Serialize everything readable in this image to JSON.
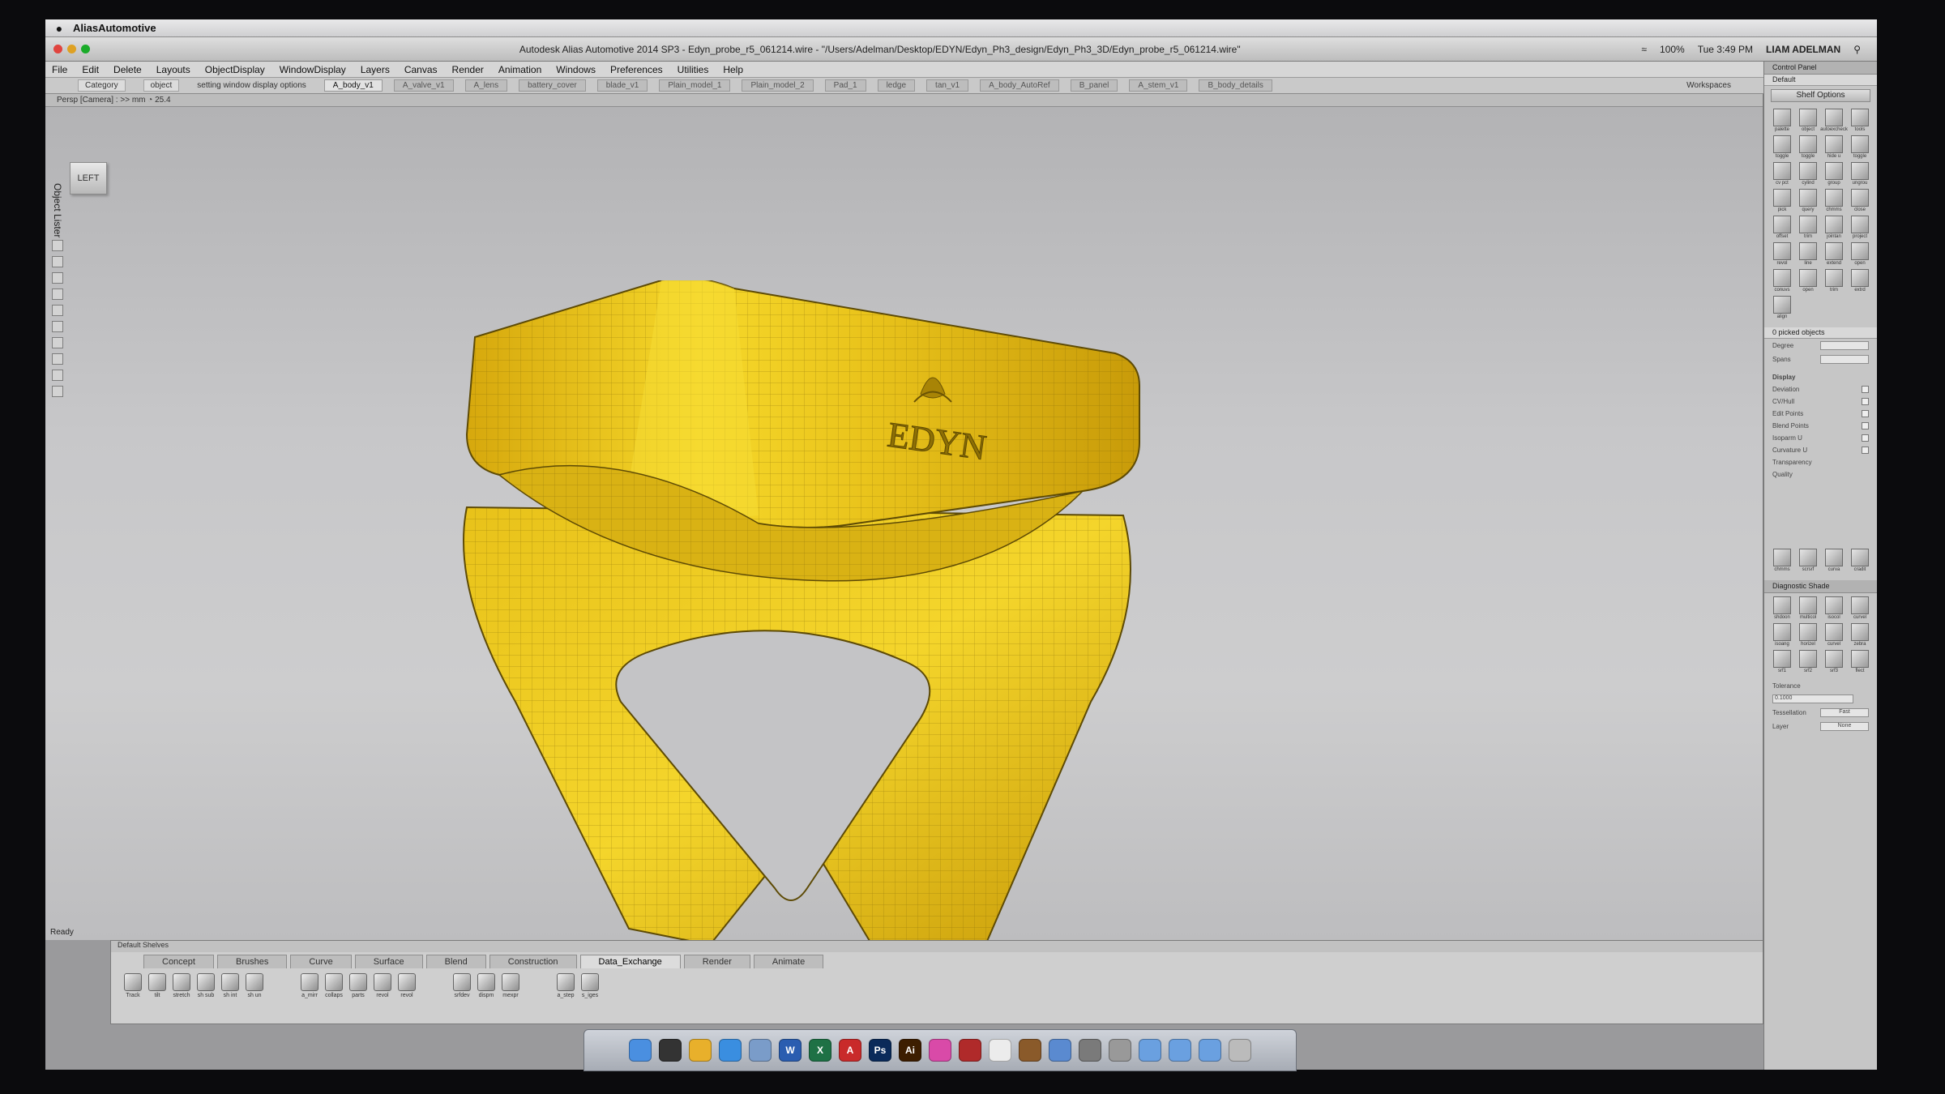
{
  "menubar": {
    "apple": "",
    "app_name": "AliasAutomotive"
  },
  "titlebar": {
    "title": "Autodesk Alias Automotive 2014 SP3  -  Edyn_probe_r5_061214.wire - \"/Users/Adelman/Desktop/EDYN/Edyn_Ph3_design/Edyn_Ph3_3D/Edyn_probe_r5_061214.wire\"",
    "battery": "100%",
    "clock": "Tue 3:49 PM",
    "user": "LIAM ADELMAN"
  },
  "app_menu": [
    "File",
    "Edit",
    "Delete",
    "Layouts",
    "ObjectDisplay",
    "WindowDisplay",
    "Layers",
    "Canvas",
    "Render",
    "Animation",
    "Windows",
    "Preferences",
    "Utilities",
    "Help"
  ],
  "shelf_row": {
    "category_label": "Category",
    "object_label": "object",
    "hint": "setting window display options",
    "tabs": [
      "A_body_v1",
      "A_valve_v1",
      "A_lens",
      "battery_cover",
      "blade_v1",
      "Plain_model_1",
      "Plain_model_2",
      "Pad_1",
      "ledge",
      "tan_v1",
      "A_body_AutoRef",
      "B_panel",
      "A_stem_v1",
      "B_body_details"
    ],
    "workspaces": "Workspaces"
  },
  "viewport": {
    "header": "Persp [Camera] : >> mm   ◔ 25.4",
    "view_cube": "LEFT",
    "object_lister": "Object Lister",
    "status": "Ready",
    "model_logo": "EDYN"
  },
  "control_panel": {
    "title": "Control Panel",
    "subtitle": "Default",
    "shelf_options": "Shelf Options",
    "tool_icons": [
      "palette",
      "object",
      "autoexcheck",
      "tools",
      "toggle",
      "toggle",
      "hide u",
      "toggle",
      "cv pct",
      "cylind",
      "group",
      "ungrou",
      "pick",
      "query",
      "chmms",
      "close",
      "offset",
      "trim",
      "jointan",
      "project",
      "revol",
      "line",
      "extend",
      "open",
      "conuvs",
      "open",
      "trim",
      "extrd",
      "align"
    ],
    "picked_objects": "0 picked objects",
    "degree_label": "Degree",
    "spans_label": "Spans",
    "display_header": "Display",
    "display_rows": [
      "Deviation",
      "CV/Hull",
      "Edit Points",
      "Blend Points",
      "Isoparm U",
      "Curvature U"
    ],
    "transparency": "Transparency",
    "quality": "Quality",
    "bottom_icons": [
      "chmms",
      "scrsrf",
      "curva",
      "cradit"
    ],
    "diagnostic_title": "Diagnostic Shade",
    "diagnostic_icons": [
      "shdoon",
      "multicol",
      "isocol",
      "curvel",
      "isoang",
      "horizel",
      "curvel",
      "zebra",
      "srf1",
      "srf2",
      "srf3",
      "flect"
    ],
    "tolerance_label": "Tolerance",
    "tolerance_value": "0.1000",
    "tessellation_label": "Tessellation",
    "tessellation_value": "Fast",
    "layer_label": "Layer",
    "layer_value": "None"
  },
  "bottom_shelf": {
    "title": "Default Shelves",
    "tabs": [
      "Concept",
      "Brushes",
      "Curve",
      "Surface",
      "Blend",
      "Construction",
      "Data_Exchange",
      "Render",
      "Animate"
    ],
    "active_tab": "Data_Exchange",
    "group1": [
      "Track",
      "tilt",
      "stretch",
      "sh sub",
      "sh int",
      "sh un"
    ],
    "group2": [
      "a_mirr",
      "collaps",
      "parts",
      "revol",
      "revol"
    ],
    "group3": [
      "srfdev",
      "dispm",
      "mexpr"
    ],
    "group4": [
      "a_step",
      "s_iges"
    ]
  },
  "dock": [
    "finder",
    "dashboard",
    "chrome",
    "safari",
    "mail",
    "word",
    "excel",
    "acrobat",
    "photoshop",
    "illustrator",
    "itunes",
    "autocad",
    "calendar",
    "photos",
    "preview",
    "settings",
    "utility",
    "folder",
    "folder",
    "folder",
    "trash"
  ],
  "colors": {
    "model_gold": "#e8c31a",
    "viewport_bg": "#c7c7c9"
  }
}
